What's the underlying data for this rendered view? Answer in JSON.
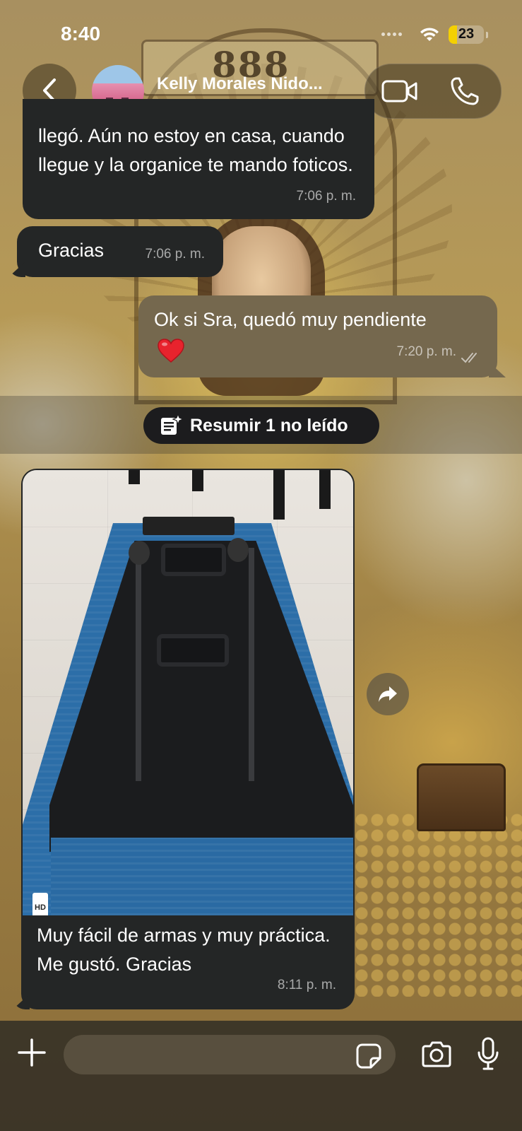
{
  "status_bar": {
    "time": "8:40",
    "battery_level": "23",
    "battery_color": "#f4d000",
    "wifi_icon": "wifi-icon"
  },
  "header": {
    "contact_name": "Kelly Morales Nido...",
    "back_icon": "chevron-left-icon",
    "video_icon": "video-camera-icon",
    "call_icon": "phone-icon"
  },
  "messages": [
    {
      "direction": "incoming",
      "text": "llegó. Aún no estoy en casa, cuando llegue y la organice te mando foticos.",
      "time": "7:06 p. m."
    },
    {
      "direction": "incoming",
      "text": "Gracias",
      "time": "7:06 p. m."
    },
    {
      "direction": "outgoing",
      "text": "Ok si Sra, quedó muy pendiente",
      "emoji": "❤️",
      "time": "7:20 p. m.",
      "read_icon": "double-check-icon"
    },
    {
      "direction": "incoming",
      "type": "image",
      "image_badge": "HD",
      "caption": "Muy fácil de armas y muy práctica. Me gustó. Gracias",
      "time": "8:11 p. m."
    }
  ],
  "unread_banner": {
    "label": "Resumir 1 no leído",
    "icon": "summarize-sparkle-icon"
  },
  "composer": {
    "placeholder": "",
    "plus_icon": "plus-icon",
    "sticker_icon": "sticker-icon",
    "camera_icon": "camera-icon",
    "mic_icon": "microphone-icon"
  },
  "colors": {
    "incoming_bubble": "#242626",
    "outgoing_bubble": "#75684e",
    "banner_pill": "#1c1c1e"
  }
}
